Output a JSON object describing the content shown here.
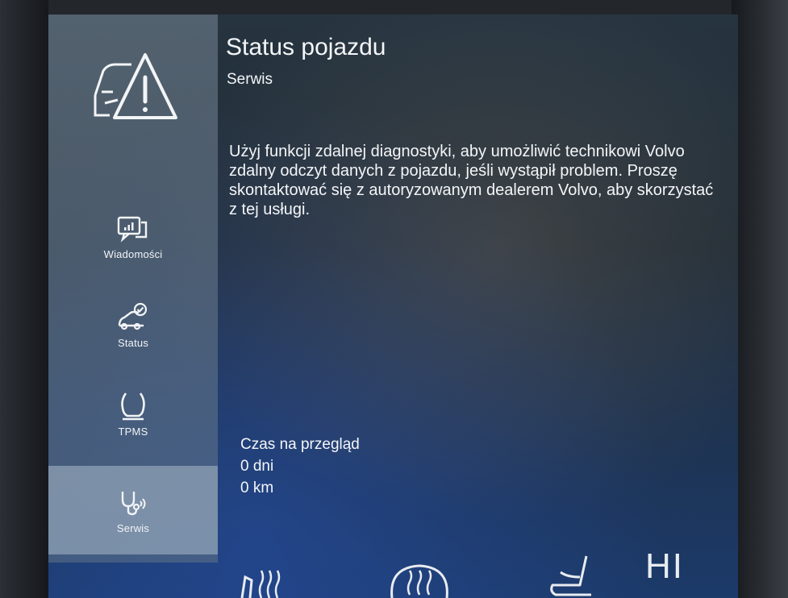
{
  "header": {
    "title": "Status pojazdu",
    "subtitle": "Serwis"
  },
  "main": {
    "description": "Użyj funkcji zdalnej diagnostyki, aby umożliwić technikowi Volvo zdalny odczyt danych z pojazdu, jeśli wystąpił problem. Proszę skontaktować się z autoryzowanym dealerem Volvo, aby skorzystać z tej usługi.",
    "service_heading": "Czas na przegląd",
    "service_days": "0 dni",
    "service_km": "0 km"
  },
  "sidebar": {
    "hero_icon": "car-warning-icon",
    "items": [
      {
        "label": "Wiadomości",
        "icon": "messages-icon"
      },
      {
        "label": "Status",
        "icon": "car-check-icon"
      },
      {
        "label": "TPMS",
        "icon": "tire-pressure-icon"
      },
      {
        "label": "Serwis",
        "icon": "service-stethoscope-icon",
        "active": true
      }
    ]
  },
  "bottom_bar": {
    "hi_label": "HI",
    "icons": [
      "seat-heat-icon",
      "defrost-icon",
      "seat-icon"
    ]
  },
  "colors": {
    "sidebar_bg": "#7f92a5",
    "active_item": "#aab9c8",
    "text": "#f4f6f8"
  }
}
